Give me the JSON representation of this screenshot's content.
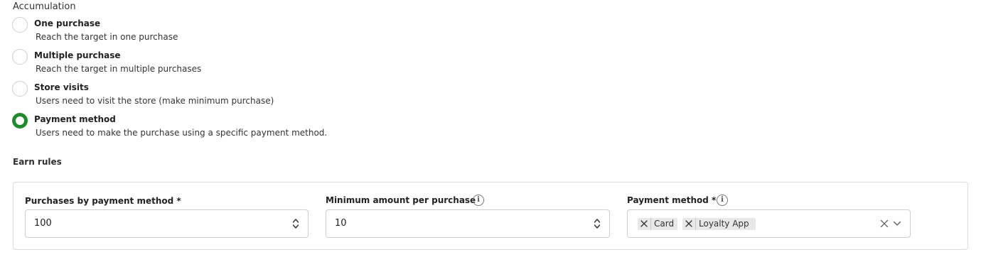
{
  "accumulation": {
    "title": "Accumulation",
    "options": [
      {
        "label": "One purchase",
        "description": "Reach the target in one purchase",
        "selected": false
      },
      {
        "label": "Multiple purchase",
        "description": "Reach the target in multiple purchases",
        "selected": false
      },
      {
        "label": "Store visits",
        "description": "Users need to visit the store (make minimum purchase)",
        "selected": false
      },
      {
        "label": "Payment method",
        "description": "Users need to make the purchase using a specific payment method.",
        "selected": true
      }
    ]
  },
  "earn_rules": {
    "title": "Earn rules",
    "purchases_by_payment_method": {
      "label": "Purchases by payment method *",
      "value": "100"
    },
    "minimum_amount": {
      "label": "Minimum amount per purchase",
      "value": "10",
      "info_icon": "info-icon"
    },
    "payment_method": {
      "label": "Payment method *",
      "info_icon": "info-icon",
      "chips": [
        "Card",
        "Loyalty App"
      ]
    }
  },
  "colors": {
    "accent": "#1f8b2c",
    "border": "#dcdcdc",
    "chip_bg": "#e8e8e8"
  }
}
